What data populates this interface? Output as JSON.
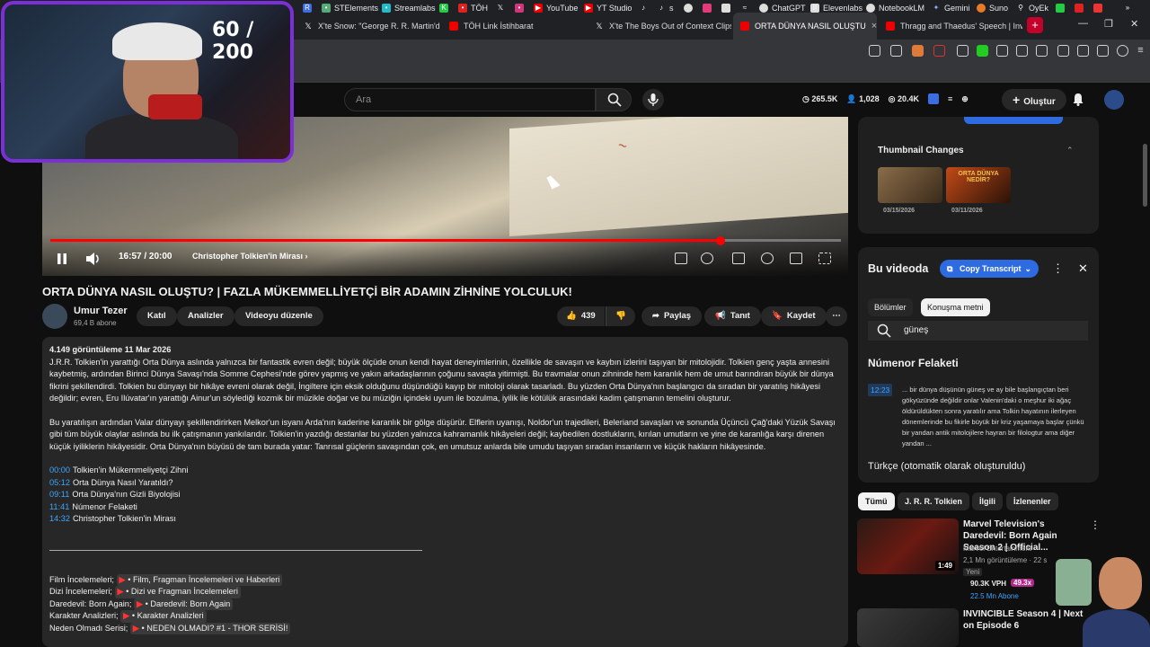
{
  "browser": {
    "tabs": [
      {
        "label": "X'te Snow: \"George R. R. Martin'den",
        "icon": "x-icon"
      },
      {
        "label": "TÖH Link İstihbarat",
        "icon": "youtube-icon"
      },
      {
        "label": "X'te The Boys Out of Context Clips: \"",
        "icon": "x-icon"
      },
      {
        "label": "ORTA DÜNYA NASIL OLUŞTU",
        "icon": "youtube-icon"
      },
      {
        "label": "Thragg and Thaedus' Speech | Invinc",
        "icon": "youtube-icon"
      }
    ],
    "bookmarks": [
      "STElements",
      "Streamlabs",
      "TÖH",
      "YouTube",
      "YT Studio",
      "s",
      "ChatGPT",
      "Elevenlabs",
      "NotebookLM",
      "Gemini",
      "Suno",
      "OyEk"
    ]
  },
  "counter": "60 / 200",
  "header": {
    "search_placeholder": "Ara",
    "stat1": "265.5K",
    "stat2": "1,028",
    "stat3": "20.4K",
    "create_label": "Oluştur"
  },
  "player": {
    "time": "16:57 / 20:00",
    "chapter": "Christopher Tolkien'in Mirası",
    "progress": 0.848
  },
  "video": {
    "title": "ORTA DÜNYA NASIL OLUŞTU? | FAZLA MÜKEMMELLİYETÇİ BİR ADAMIN ZİHNİNE YOLCULUK!",
    "channel": "Umur Tezer",
    "subscribers": "69,4 B abone",
    "join": "Katıl",
    "analytics": "Analizler",
    "edit": "Videoyu düzenle",
    "likes": "439",
    "share": "Paylaş",
    "promote": "Tanıt",
    "save": "Kaydet"
  },
  "description": {
    "meta": "4.149 görüntüleme  11 Mar 2026",
    "p1": "J.R.R. Tolkien'in yarattığı Orta Dünya aslında yalnızca bir fantastik evren değil; büyük ölçüde onun kendi hayat deneyimlerinin, özellikle de savaşın ve kaybın izlerini taşıyan bir mitolojidir. Tolkien genç yaşta annesini kaybetmiş, ardından Birinci Dünya Savaşı'nda Somme Cephesi'nde görev yapmış ve yakın arkadaşlarının çoğunu savaşta yitirmişti. Bu travmalar onun zihninde hem karanlık hem de umut barındıran büyük bir dünya fikrini şekillendirdi. Tolkien bu dünyayı bir hikâye evreni olarak değil, İngiltere için eksik olduğunu düşündüğü kayıp bir mitoloji olarak tasarladı. Bu yüzden Orta Dünya'nın başlangıcı da sıradan bir yaratılış hikâyesi değildir; evren, Eru Ilúvatar'ın yarattığı Ainur'un söylediği kozmik bir müzikle doğar ve bu müziğin içindeki uyum ile bozulma, iyilik ile kötülük arasındaki kadim çatışmanın temelini oluşturur.",
    "p2": "Bu yaratılışın ardından Valar dünyayı şekillendirirken Melkor'un isyanı Arda'nın kaderine karanlık bir gölge düşürür. Elflerin uyanışı, Noldor'un trajedileri, Beleriand savaşları ve sonunda Üçüncü Çağ'daki Yüzük Savaşı gibi tüm büyük olaylar aslında bu ilk çatışmanın yankılarıdır. Tolkien'in yazdığı destanlar bu yüzden yalnızca kahramanlık hikâyeleri değil; kaybedilen dostlukların, kırılan umutların ve yine de karanlığa karşı direnen küçük iyiliklerin hikâyesidir. Orta Dünya'nın büyüsü de tam burada yatar: Tanrısal güçlerin savaşından çok, en umutsuz anlarda bile umudu taşıyan sıradan insanların ve küçük hakların hikâyesinde.",
    "chapters": [
      {
        "time": "00:00",
        "title": "Tolkien'in Mükemmeliyetçi Zihni"
      },
      {
        "time": "05:12",
        "title": "Orta Dünya Nasıl Yaratıldı?"
      },
      {
        "time": "09:11",
        "title": "Orta Dünya'nın Gizli Biyolojisi"
      },
      {
        "time": "11:41",
        "title": "Númenor Felaketi"
      },
      {
        "time": "14:32",
        "title": "Christopher Tolkien'in Mirası"
      }
    ],
    "links": [
      {
        "label": "Film İncelemeleri;",
        "target": "• Film, Fragman İncelemeleri ve Haberleri"
      },
      {
        "label": "Dizi İncelemeleri;",
        "target": "• Dizi ve Fragman İncelemeleri"
      },
      {
        "label": "Daredevil: Born Again;",
        "target": "• Daredevil: Born Again"
      },
      {
        "label": "Karakter Analizleri;",
        "target": "• Karakter Analizleri"
      },
      {
        "label": "Neden Olmadı Serisi;",
        "target": "• NEDEN OLMADI? #1 - THOR SERİSİ!"
      }
    ]
  },
  "thumbnail_changes": {
    "title": "Thumbnail Changes",
    "dates": [
      "03/15/2026",
      "03/11/2026"
    ],
    "thumb2_text": "ORTA DÜNYA NEDİR?"
  },
  "in_video": {
    "title": "Bu videoda",
    "copy": "Copy Transcript",
    "tab1": "Bölümler",
    "tab2": "Konuşma metni",
    "search_value": "güneş",
    "section": "Númenor Felaketi",
    "timestamp": "12:23",
    "snippet": "... bir dünya düşünün güneş ve ay bile başlangıçtan beri gökyüzünde değildir onlar Valenin'daki o meşhur iki ağaç öldürüldükten sonra yaratılır ama Tolkin hayatının ilerleyen dönemlerinde bu fikirle büyük bir kriz yaşamaya başlar çünkü bir yandan antik mitolojilere hayran bir filologtur ama diğer yandan ...",
    "language": "Türkçe (otomatik olarak oluşturuldu)"
  },
  "chips": [
    "Tümü",
    "J. R. R. Tolkien",
    "İlgili",
    "İzlenenler"
  ],
  "recommendations": [
    {
      "title": "Marvel Television's Daredevil: Born Again Season 2 | Official...",
      "channel": "Marvel Entertainment",
      "meta": "2,1 Mn görüntüleme · 22 s",
      "badge": "Yeni",
      "duration": "1:49",
      "vph": "90.3K VPH",
      "mult": "49.3x",
      "subs": "22.5 Mn Abone"
    },
    {
      "title": "INVINCIBLE Season 4 | Next on Episode 6",
      "channel": "",
      "meta": "",
      "badge": "",
      "duration": "",
      "vph": "",
      "mult": "",
      "subs": ""
    }
  ]
}
